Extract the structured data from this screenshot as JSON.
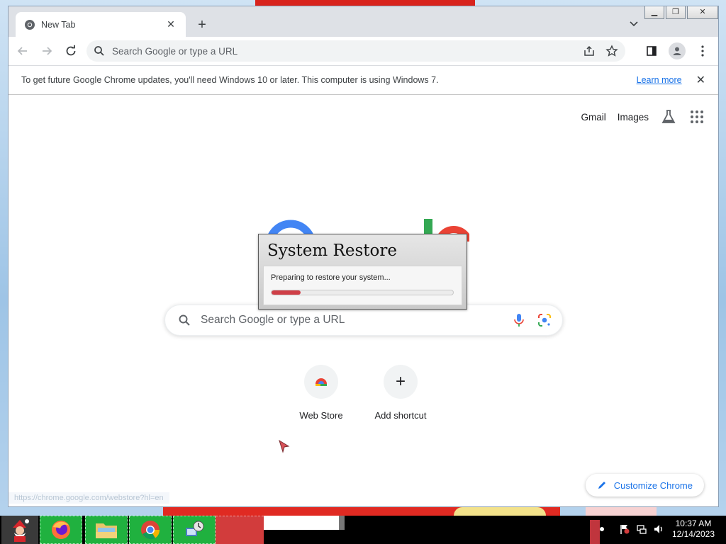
{
  "desktop": {
    "taskbar": {
      "start_icon": "santa-icon",
      "apps": [
        {
          "name": "firefox",
          "icon": "firefox-icon"
        },
        {
          "name": "file-explorer",
          "icon": "folder-icon"
        },
        {
          "name": "chrome",
          "icon": "chrome-icon"
        },
        {
          "name": "network-settings",
          "icon": "network-tool-icon"
        }
      ],
      "clock": {
        "time": "10:37 AM",
        "date": "12/14/2023"
      }
    }
  },
  "browser": {
    "tab": {
      "title": "New Tab",
      "favicon": "chrome-favicon"
    },
    "omnibox": {
      "placeholder": "Search Google or type a URL"
    },
    "infobar": {
      "message": "To get future Google Chrome updates, you'll need Windows 10 or later. This computer is using Windows 7.",
      "link": "Learn more"
    },
    "top_links": {
      "gmail": "Gmail",
      "images": "Images"
    },
    "search": {
      "placeholder": "Search Google or type a URL"
    },
    "shortcuts": [
      {
        "label": "Web Store",
        "icon": "web-store-icon"
      },
      {
        "label": "Add shortcut",
        "icon": "plus-icon",
        "glyph": "+"
      }
    ],
    "customize_label": "Customize Chrome",
    "status_url": "https://chrome.google.com/webstore?hl=en"
  },
  "dialog": {
    "title": "System Restore",
    "message": "Preparing to restore your system...",
    "progress": 0.16
  },
  "colors": {
    "accent": "#1a73e8",
    "progress": "#cf3f47",
    "tabstrip": "#dee1e6",
    "taskbar": "#000000",
    "taskbar_app": "#20b13f"
  }
}
